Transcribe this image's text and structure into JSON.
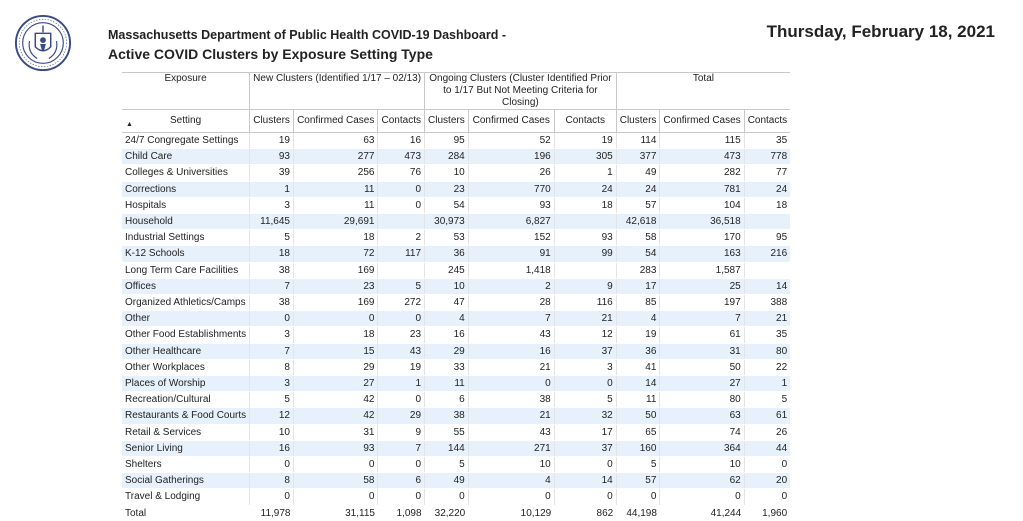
{
  "header": {
    "title_line1": "Massachusetts Department of Public Health COVID-19 Dashboard -",
    "title_line2": "Active COVID Clusters by Exposure Setting Type",
    "date": "Thursday, February 18, 2021"
  },
  "table": {
    "group_headers": [
      "Exposure",
      "New Clusters (Identified 1/17 – 02/13)",
      "Ongoing Clusters (Cluster Identified Prior to 1/17 But Not Meeting Criteria for Closing)",
      "Total"
    ],
    "columns": [
      "Setting",
      "Clusters",
      "Confirmed Cases",
      "Contacts",
      "Clusters",
      "Confirmed Cases",
      "Contacts",
      "Clusters",
      "Confirmed Cases",
      "Contacts"
    ],
    "rows": [
      [
        "24/7 Congregate Settings",
        "19",
        "63",
        "16",
        "95",
        "52",
        "19",
        "114",
        "115",
        "35"
      ],
      [
        "Child Care",
        "93",
        "277",
        "473",
        "284",
        "196",
        "305",
        "377",
        "473",
        "778"
      ],
      [
        "Colleges & Universities",
        "39",
        "256",
        "76",
        "10",
        "26",
        "1",
        "49",
        "282",
        "77"
      ],
      [
        "Corrections",
        "1",
        "11",
        "0",
        "23",
        "770",
        "24",
        "24",
        "781",
        "24"
      ],
      [
        "Hospitals",
        "3",
        "11",
        "0",
        "54",
        "93",
        "18",
        "57",
        "104",
        "18"
      ],
      [
        "Household",
        "11,645",
        "29,691",
        "",
        "30,973",
        "6,827",
        "",
        "42,618",
        "36,518",
        ""
      ],
      [
        "Industrial Settings",
        "5",
        "18",
        "2",
        "53",
        "152",
        "93",
        "58",
        "170",
        "95"
      ],
      [
        "K-12 Schools",
        "18",
        "72",
        "117",
        "36",
        "91",
        "99",
        "54",
        "163",
        "216"
      ],
      [
        "Long Term Care Facilities",
        "38",
        "169",
        "",
        "245",
        "1,418",
        "",
        "283",
        "1,587",
        ""
      ],
      [
        "Offices",
        "7",
        "23",
        "5",
        "10",
        "2",
        "9",
        "17",
        "25",
        "14"
      ],
      [
        "Organized Athletics/Camps",
        "38",
        "169",
        "272",
        "47",
        "28",
        "116",
        "85",
        "197",
        "388"
      ],
      [
        "Other",
        "0",
        "0",
        "0",
        "4",
        "7",
        "21",
        "4",
        "7",
        "21"
      ],
      [
        "Other Food Establishments",
        "3",
        "18",
        "23",
        "16",
        "43",
        "12",
        "19",
        "61",
        "35"
      ],
      [
        "Other Healthcare",
        "7",
        "15",
        "43",
        "29",
        "16",
        "37",
        "36",
        "31",
        "80"
      ],
      [
        "Other Workplaces",
        "8",
        "29",
        "19",
        "33",
        "21",
        "3",
        "41",
        "50",
        "22"
      ],
      [
        "Places of Worship",
        "3",
        "27",
        "1",
        "11",
        "0",
        "0",
        "14",
        "27",
        "1"
      ],
      [
        "Recreation/Cultural",
        "5",
        "42",
        "0",
        "6",
        "38",
        "5",
        "11",
        "80",
        "5"
      ],
      [
        "Restaurants & Food Courts",
        "12",
        "42",
        "29",
        "38",
        "21",
        "32",
        "50",
        "63",
        "61"
      ],
      [
        "Retail & Services",
        "10",
        "31",
        "9",
        "55",
        "43",
        "17",
        "65",
        "74",
        "26"
      ],
      [
        "Senior Living",
        "16",
        "93",
        "7",
        "144",
        "271",
        "37",
        "160",
        "364",
        "44"
      ],
      [
        "Shelters",
        "0",
        "0",
        "0",
        "5",
        "10",
        "0",
        "5",
        "10",
        "0"
      ],
      [
        "Social Gatherings",
        "8",
        "58",
        "6",
        "49",
        "4",
        "14",
        "57",
        "62",
        "20"
      ],
      [
        "Travel & Lodging",
        "0",
        "0",
        "0",
        "0",
        "0",
        "0",
        "0",
        "0",
        "0"
      ]
    ],
    "total": [
      "Total",
      "11,978",
      "31,115",
      "1,098",
      "32,220",
      "10,129",
      "862",
      "44,198",
      "41,244",
      "1,960"
    ]
  }
}
